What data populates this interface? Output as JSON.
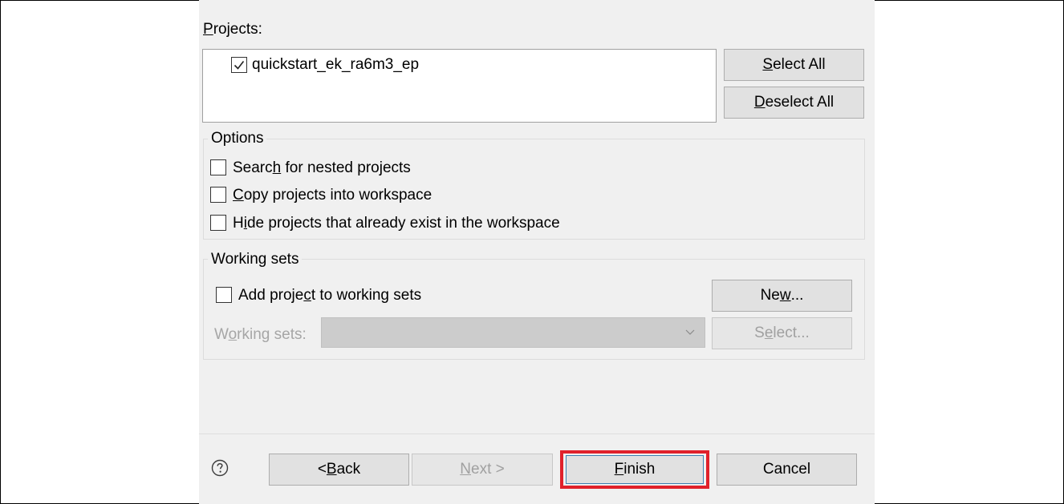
{
  "projects": {
    "label_pre": "",
    "label_mn": "P",
    "label_post": "rojects:",
    "items": [
      {
        "name": "quickstart_ek_ra6m3_ep",
        "checked": true
      }
    ],
    "select_all": {
      "pre": "",
      "mn": "S",
      "post": "elect All"
    },
    "deselect_all": {
      "pre": "",
      "mn": "D",
      "post": "eselect All"
    }
  },
  "options": {
    "title": "Options",
    "search_nested": {
      "pre": "Searc",
      "mn": "h",
      "post": " for nested projects",
      "checked": false
    },
    "copy_projects": {
      "pre": "",
      "mn": "C",
      "post": "opy projects into workspace",
      "checked": false
    },
    "hide_existing": {
      "pre": "H",
      "mn": "i",
      "post": "de projects that already exist in the workspace",
      "checked": false
    }
  },
  "working_sets": {
    "title": "Working sets",
    "add_to_sets": {
      "pre": "Add proje",
      "mn": "c",
      "post": "t to working sets",
      "checked": false
    },
    "new_button": {
      "pre": "Ne",
      "mn": "w",
      "post": "..."
    },
    "combo_label": {
      "pre": "W",
      "mn": "o",
      "post": "rking sets:"
    },
    "combo_value": "",
    "select_button": {
      "pre": "S",
      "mn": "e",
      "post": "lect..."
    }
  },
  "footer": {
    "help_icon": "help-icon",
    "back": {
      "pre": "< ",
      "mn": "B",
      "post": "ack"
    },
    "next": {
      "pre": "",
      "mn": "N",
      "post": "ext >"
    },
    "finish": {
      "pre": "",
      "mn": "F",
      "post": "inish"
    },
    "cancel": "Cancel",
    "highlight_color": "#e0212b"
  }
}
